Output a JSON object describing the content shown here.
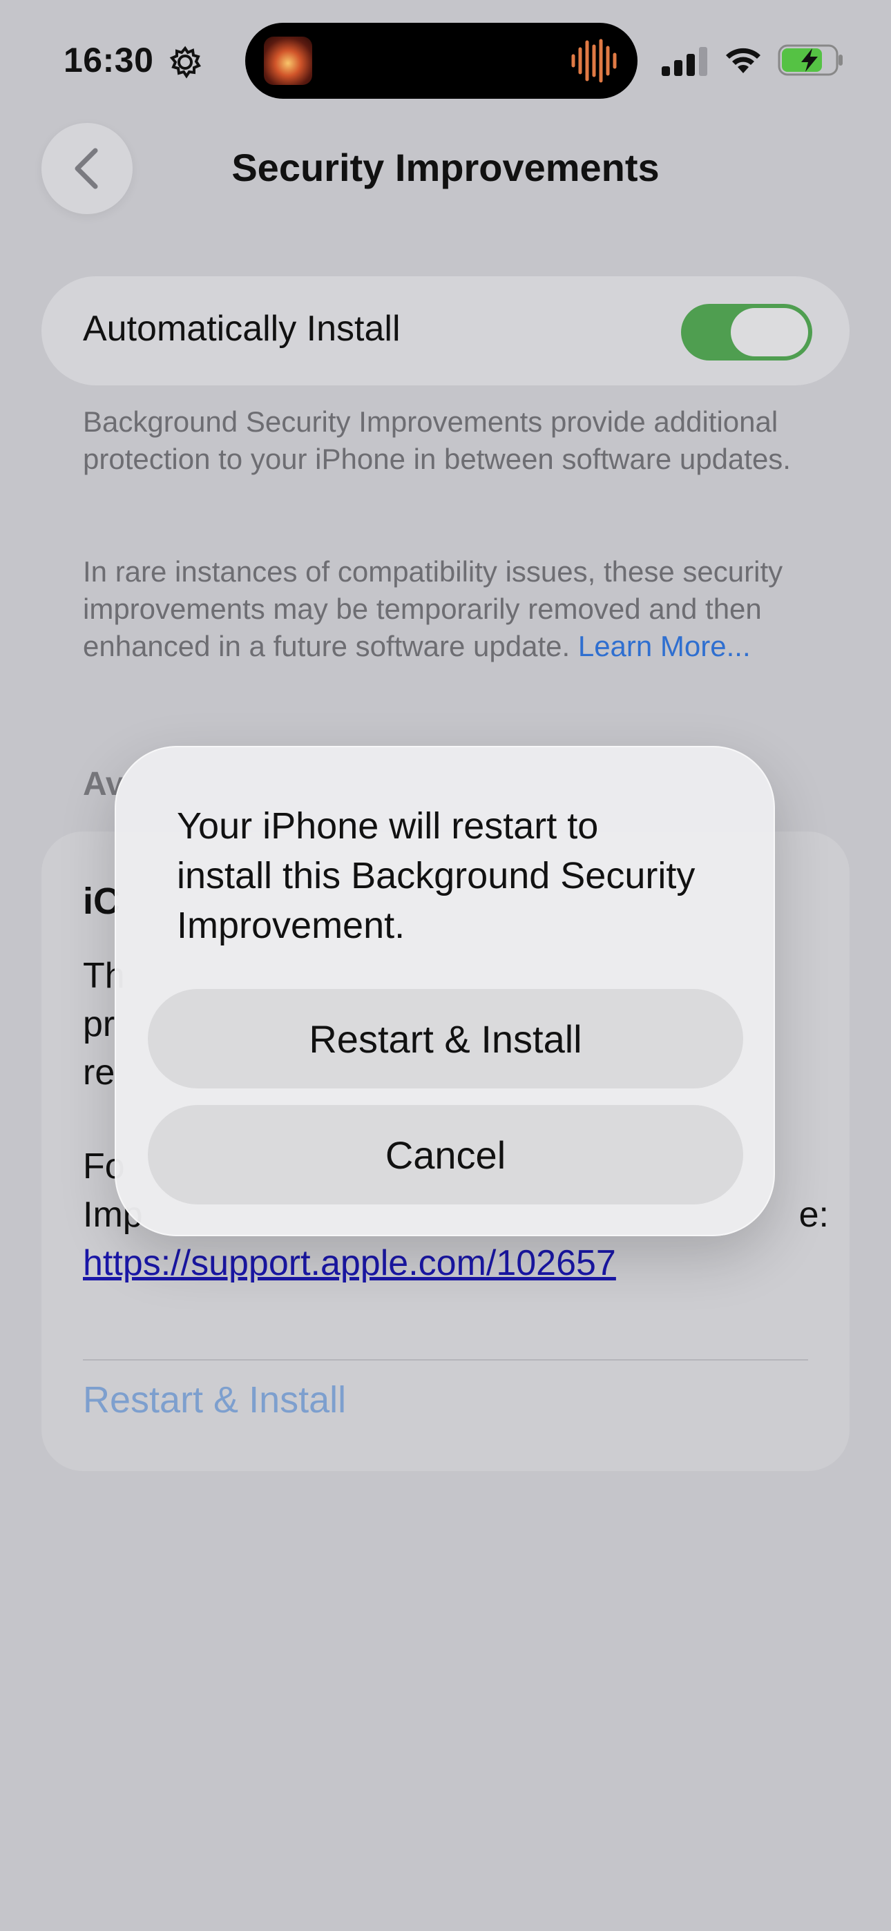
{
  "status_bar": {
    "time": "16:30",
    "icons": [
      "gear-icon",
      "signal-icon",
      "wifi-icon",
      "battery-charging-icon"
    ]
  },
  "nav": {
    "title": "Security Improvements",
    "back_icon": "chevron-left-icon"
  },
  "auto_install": {
    "label": "Automatically Install",
    "toggle_on": true,
    "toggle_color": "#4f9e50"
  },
  "footer": {
    "paragraph1": "Background Security Improvements provide additional protection to your iPhone in between software updates.",
    "paragraph2": "In rare instances of compatibility issues, these security improvements may be temporarily removed and then enhanced in a future software update.",
    "learn_more": "Learn More..."
  },
  "section": {
    "header_partial": "Av"
  },
  "update_card": {
    "heading_partial": "iC",
    "body_partial_lines": [
      "Th",
      "pr",
      "re"
    ],
    "more_partial_lines": [
      "Fo",
      "Imp"
    ],
    "more_trailing": "e:",
    "url": "https://support.apple.com/102657",
    "action": "Restart & Install"
  },
  "alert": {
    "message": "Your iPhone will restart to install this Background Security Improvement.",
    "primary": "Restart & Install",
    "cancel": "Cancel"
  },
  "colors": {
    "link": "#2f6fd0",
    "url": "#1a17a8",
    "disabled_action": "#7d9fce"
  }
}
